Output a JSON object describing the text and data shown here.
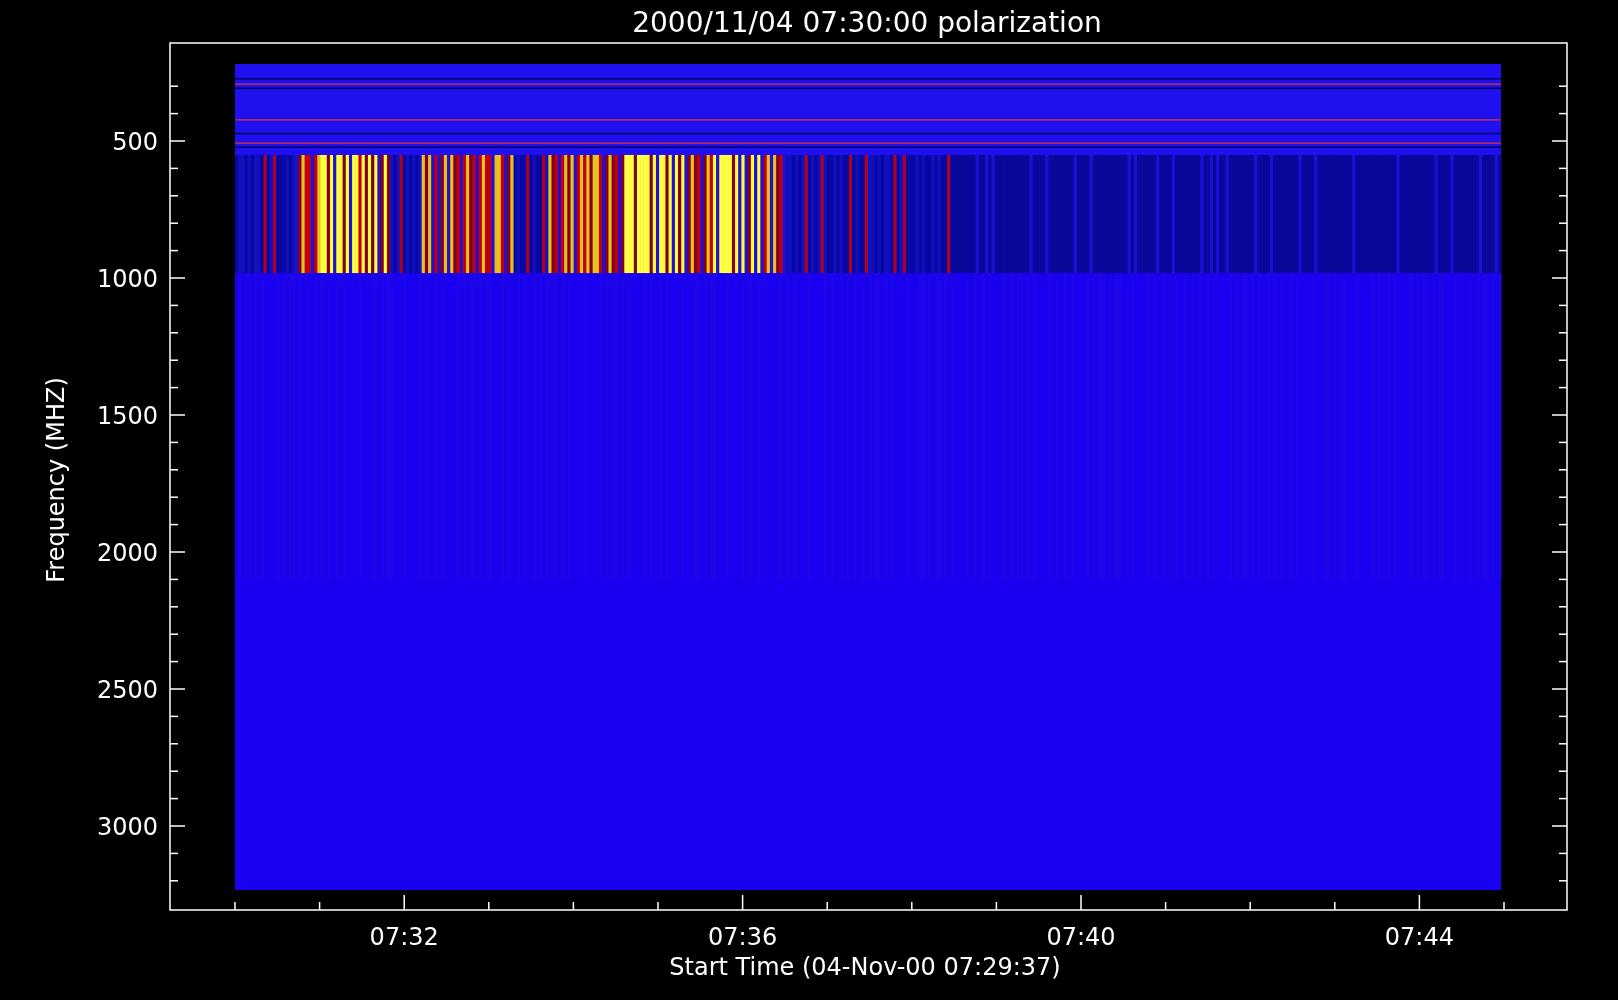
{
  "title": "2000/11/04 07:30:00 polarization",
  "y_axis": {
    "label": "Frequency (MHZ)",
    "ticks": [
      "500",
      "1000",
      "1500",
      "2000",
      "2500",
      "3000"
    ]
  },
  "x_axis": {
    "label": "Start Time (04-Nov-00 07:29:37)",
    "ticks": [
      "07:32",
      "07:36",
      "07:40",
      "07:44"
    ]
  }
}
